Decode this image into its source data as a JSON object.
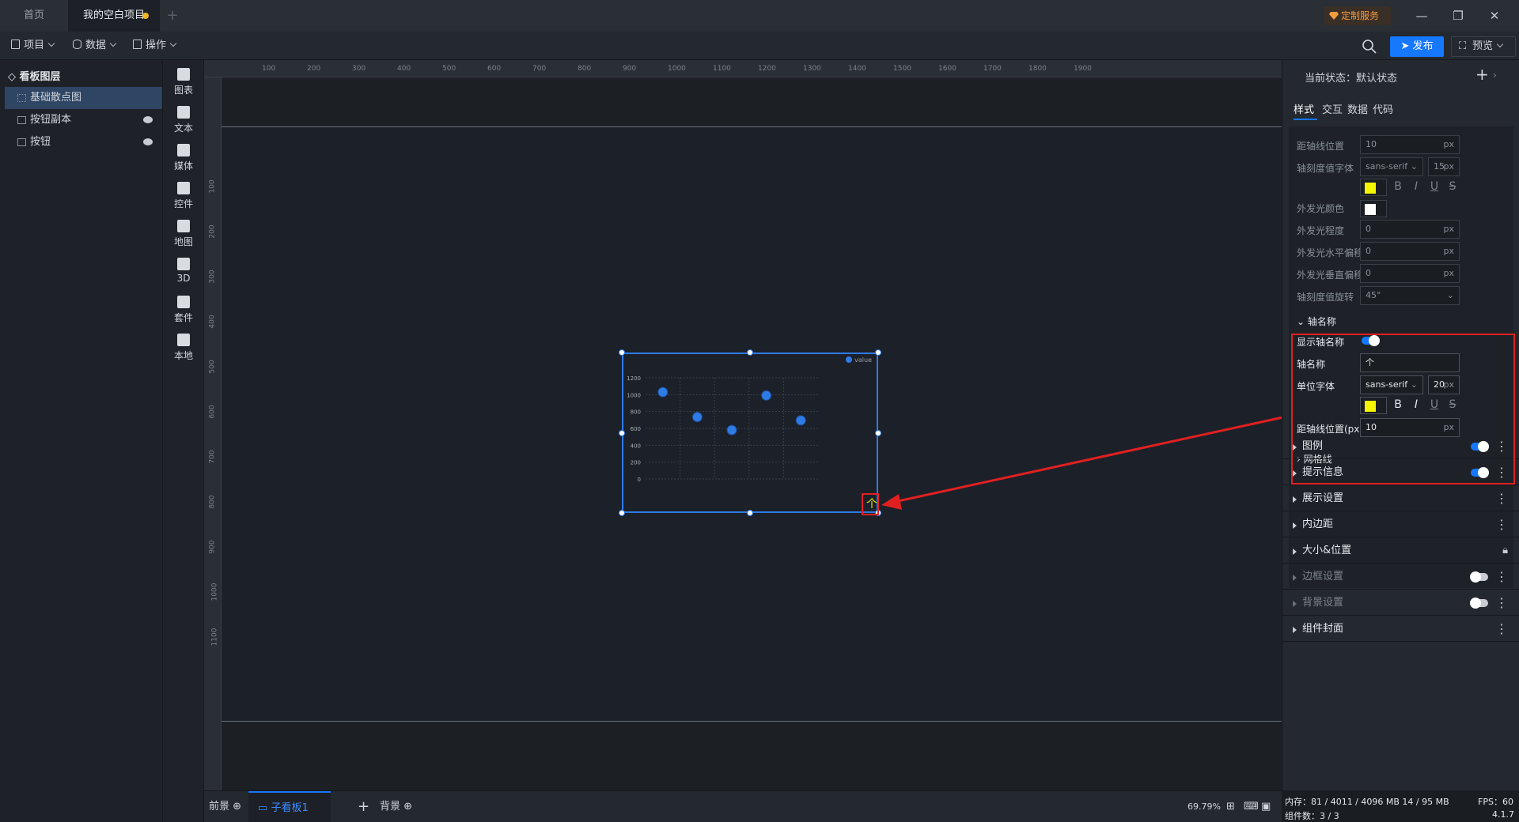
{
  "tabs": {
    "home": "首页",
    "project": "我的空白项目"
  },
  "header": {
    "custom_service": "定制服务",
    "publish": "发布",
    "preview": "预览"
  },
  "toolbar": {
    "project": "项目",
    "data": "数据",
    "operate": "操作"
  },
  "layers": {
    "title": "看板图层",
    "items": [
      {
        "label": "基础散点图"
      },
      {
        "label": "按钮副本"
      },
      {
        "label": "按钮"
      }
    ]
  },
  "components": [
    "图表",
    "文本",
    "媒体",
    "控件",
    "地图",
    "3D",
    "套件",
    "本地"
  ],
  "ruler": {
    "top": [
      "100",
      "200",
      "300",
      "400",
      "500",
      "600",
      "700",
      "800",
      "900",
      "1000",
      "1100",
      "1200",
      "1300",
      "1400",
      "1500",
      "1600",
      "1700",
      "1800",
      "1900"
    ],
    "left": [
      "100",
      "200",
      "300",
      "400",
      "500",
      "600",
      "700",
      "800",
      "900",
      "1000",
      "1100"
    ]
  },
  "chart_data": {
    "type": "scatter",
    "legend": [
      "value"
    ],
    "y_ticks": [
      "1200",
      "1000",
      "800",
      "600",
      "400",
      "200",
      "0"
    ],
    "ylim": [
      0,
      1200
    ],
    "series": [
      {
        "name": "value",
        "points": [
          [
            1,
            1030
          ],
          [
            2,
            735
          ],
          [
            3,
            580
          ],
          [
            4,
            990
          ],
          [
            5,
            695
          ]
        ]
      }
    ],
    "xlim": [
      0.5,
      5.5
    ],
    "colors": {
      "point": "#2f7be6"
    }
  },
  "axis_name_marker": "个",
  "bottom": {
    "front": "前景",
    "sub": "子看板1",
    "background": "背景",
    "zoom": "69.79%"
  },
  "panel": {
    "state": "当前状态：默认状态",
    "tabs": [
      "样式",
      "交互",
      "数据",
      "代码"
    ],
    "dim_rows": {
      "axis_line_pos": {
        "label": "距轴线位置",
        "value": "10",
        "unit": "px"
      },
      "tick_font": {
        "label": "轴刻度值字体",
        "value": "sans-serif",
        "size": "15",
        "unit": "px"
      },
      "glow_color": {
        "label": "外发光颜色"
      },
      "glow_degree": {
        "label": "外发光程度",
        "value": "0",
        "unit": "px"
      },
      "glow_h": {
        "label": "外发光水平偏移",
        "value": "0",
        "unit": "px"
      },
      "glow_v": {
        "label": "外发光垂直偏移",
        "value": "0",
        "unit": "px"
      },
      "tick_rotate": {
        "label": "轴刻度值旋转",
        "value": "45°"
      }
    },
    "axis_name": {
      "title": "轴名称",
      "show_label": "显示轴名称",
      "name_label": "轴名称",
      "name_value": "个",
      "font_label": "单位字体",
      "font_value": "sans-serif",
      "font_size": "20",
      "unit": "px",
      "offset_label": "距轴线位置(px)",
      "offset_value": "10"
    },
    "gridline": "网格线",
    "sections": [
      "图例",
      "提示信息",
      "展示设置",
      "内边距",
      "大小&位置",
      "边框设置",
      "背景设置",
      "组件封面"
    ],
    "colors": {
      "yellow": "#f5f500",
      "white": "#ffffff",
      "accent": "#1677ff",
      "highlight": "#e02020"
    }
  },
  "format_buttons": [
    "B",
    "I",
    "U",
    "S"
  ],
  "status": {
    "memory": "内存：81 / 4011 / 4096 MB  14 / 95 MB",
    "fps": "FPS：60",
    "count": "组件数：3 / 3",
    "version": "4.1.7"
  }
}
